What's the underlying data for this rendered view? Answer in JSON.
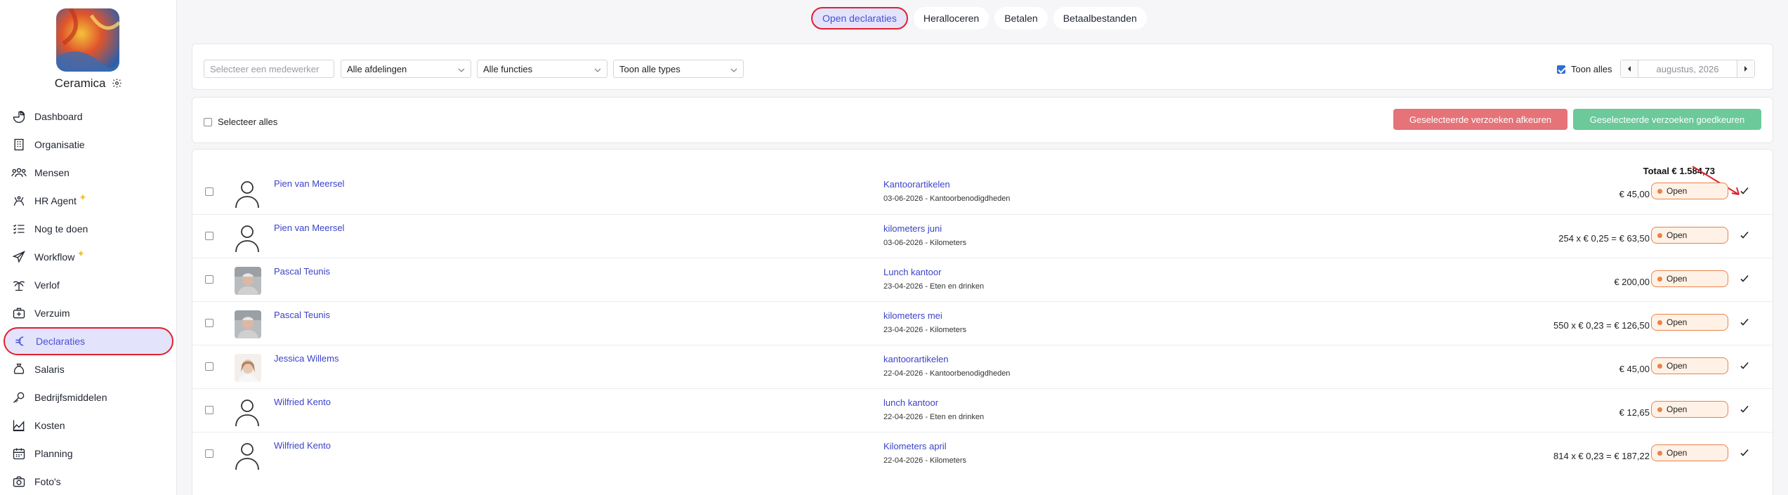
{
  "company": {
    "name": "Ceramica"
  },
  "sidebar": {
    "items": [
      {
        "label": "Dashboard",
        "icon": "dashboard-icon"
      },
      {
        "label": "Organisatie",
        "icon": "building-icon"
      },
      {
        "label": "Mensen",
        "icon": "people-icon"
      },
      {
        "label": "HR Agent",
        "icon": "agent-icon",
        "sparkle": true
      },
      {
        "label": "Nog te doen",
        "icon": "checklist-icon"
      },
      {
        "label": "Workflow",
        "icon": "paper-plane-icon",
        "sparkle": true
      },
      {
        "label": "Verlof",
        "icon": "palm-tree-icon"
      },
      {
        "label": "Verzuim",
        "icon": "medical-bag-icon"
      },
      {
        "label": "Declaraties",
        "icon": "euro-icon",
        "active": true
      },
      {
        "label": "Salaris",
        "icon": "money-bag-icon"
      },
      {
        "label": "Bedrijfsmiddelen",
        "icon": "key-icon"
      },
      {
        "label": "Kosten",
        "icon": "chart-area-icon"
      },
      {
        "label": "Planning",
        "icon": "calendar-icon"
      },
      {
        "label": "Foto's",
        "icon": "camera-icon"
      }
    ]
  },
  "tabs": [
    {
      "label": "Open declaraties",
      "active": true
    },
    {
      "label": "Heralloceren"
    },
    {
      "label": "Betalen"
    },
    {
      "label": "Betaalbestanden"
    }
  ],
  "filters": {
    "employee_placeholder": "Selecteer een medewerker",
    "department": "Alle afdelingen",
    "function": "Alle functies",
    "type": "Toon alle types",
    "show_all_label": "Toon alles",
    "show_all_checked": true,
    "month": "augustus, 2026"
  },
  "actions": {
    "select_all": "Selecteer alles",
    "reject": "Geselecteerde verzoeken afkeuren",
    "approve": "Geselecteerde verzoeken goedkeuren"
  },
  "total": "Totaal € 1.584,73",
  "rows": [
    {
      "name": "Pien van Meersel",
      "avatar": "placeholder",
      "title": "Kantoorartikelen",
      "sub": "03-06-2026 - Kantoorbenodigdheden",
      "amount": "€ 45,00",
      "status": "Open"
    },
    {
      "name": "Pien van Meersel",
      "avatar": "placeholder",
      "title": "kilometers juni",
      "sub": "03-06-2026 - Kilometers",
      "amount": "254 x € 0,25 = € 63,50",
      "status": "Open"
    },
    {
      "name": "Pascal Teunis",
      "avatar": "photo-man",
      "title": "Lunch kantoor",
      "sub": "23-04-2026 - Eten en drinken",
      "amount": "€ 200,00",
      "status": "Open"
    },
    {
      "name": "Pascal Teunis",
      "avatar": "photo-man",
      "title": "kilometers mei",
      "sub": "23-04-2026 - Kilometers",
      "amount": "550 x € 0,23 = € 126,50",
      "status": "Open"
    },
    {
      "name": "Jessica Willems",
      "avatar": "photo-woman",
      "title": "kantoorartikelen",
      "sub": "22-04-2026 - Kantoorbenodigdheden",
      "amount": "€ 45,00",
      "status": "Open"
    },
    {
      "name": "Wilfried Kento",
      "avatar": "placeholder",
      "title": "lunch kantoor",
      "sub": "22-04-2026 - Eten en drinken",
      "amount": "€ 12,65",
      "status": "Open"
    },
    {
      "name": "Wilfried Kento",
      "avatar": "placeholder",
      "title": "Kilometers april",
      "sub": "22-04-2026 - Kilometers",
      "amount": "814 x € 0,23 = € 187,22",
      "status": "Open"
    }
  ],
  "colors": {
    "accent": "#4a4fd6",
    "highlight": "#e21f2e",
    "reject": "#e57378",
    "approve": "#6bc99a",
    "status": "#e9834a"
  }
}
